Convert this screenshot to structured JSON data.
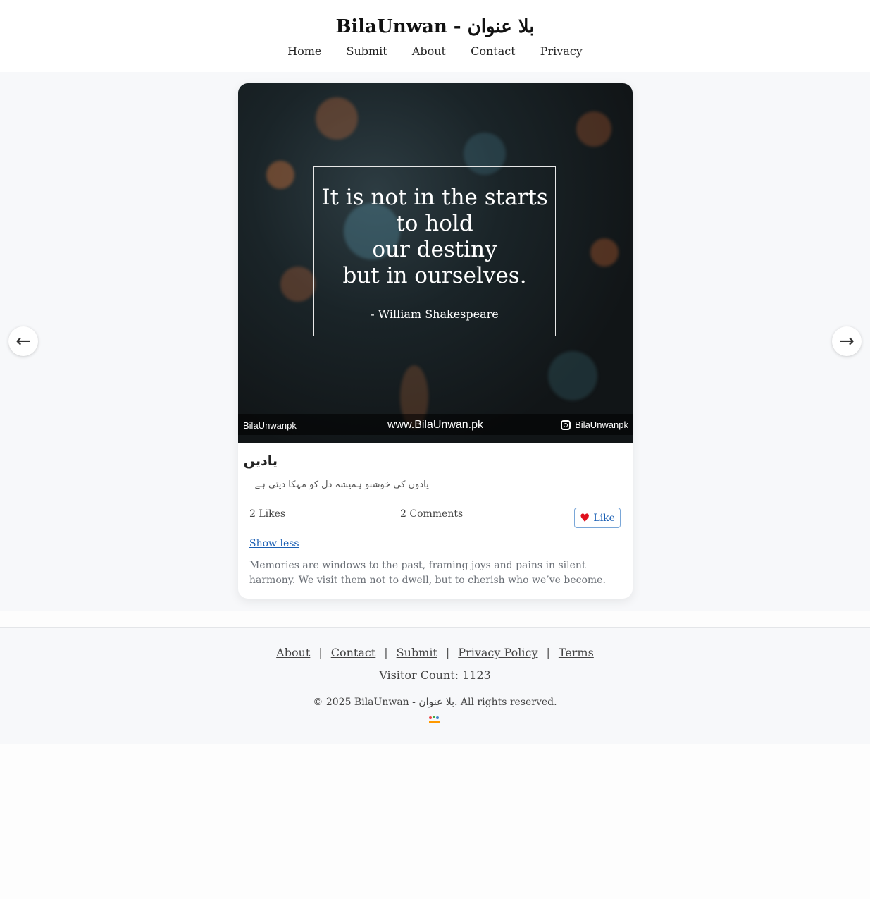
{
  "site": {
    "title": "BilaUnwan - بلا عنوان"
  },
  "nav": {
    "items": [
      {
        "label": "Home"
      },
      {
        "label": "Submit"
      },
      {
        "label": "About"
      },
      {
        "label": "Contact"
      },
      {
        "label": "Privacy"
      }
    ]
  },
  "carousel": {
    "prev_icon": "←",
    "next_icon": "→"
  },
  "post": {
    "image": {
      "quote": "It is not in the starts\nto hold\nour destiny\nbut in ourselves.",
      "author": "- William Shakespeare",
      "watermark_left": "BilaUnwanpk",
      "watermark_center": "www.BilaUnwan.pk",
      "watermark_right": "BilaUnwanpk"
    },
    "title": "یادیں",
    "excerpt": "یادوں کی خوشبو ہمیشہ دل کو مہکا دیتی ہے۔",
    "likes": "2 Likes",
    "comments": "2 Comments",
    "like_button": "Like",
    "like_icon": "heart-icon",
    "show_less": "Show less",
    "description": "Memories are windows to the past, framing joys and pains in silent harmony. We visit them not to dwell, but to cherish who we’ve become."
  },
  "footer": {
    "links": [
      {
        "label": "About"
      },
      {
        "label": "Contact"
      },
      {
        "label": "Submit"
      },
      {
        "label": "Privacy Policy"
      },
      {
        "label": "Terms"
      }
    ],
    "separator": "|",
    "visitor_count": "Visitor Count: 1123",
    "copyright": "© 2025 BilaUnwan - بلا عنوان. All rights reserved."
  },
  "colors": {
    "accent": "#1a5fb4",
    "heart": "#e0101e",
    "page_bg": "#f7f8fa"
  }
}
